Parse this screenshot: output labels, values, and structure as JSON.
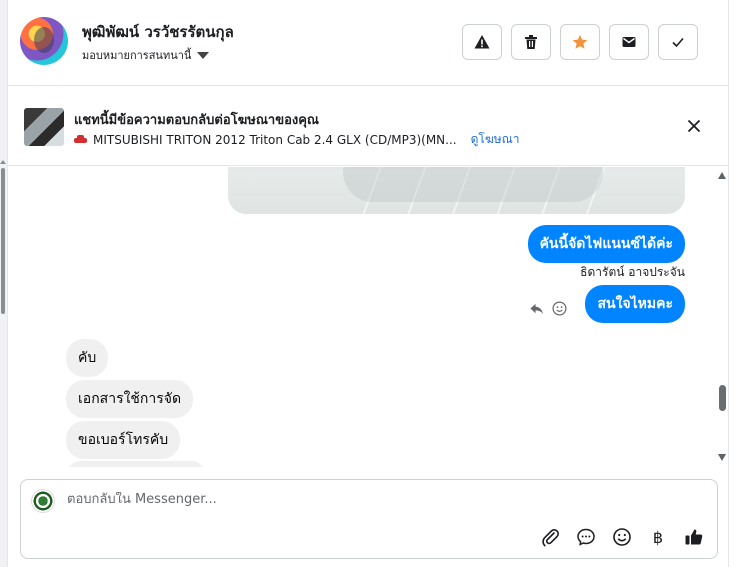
{
  "header": {
    "user_name": "พุฒิพัฒน์ วรวัชรรัตนกุล",
    "assign_label": "มอบหมายการสนทนานี้",
    "actions": [
      "warning-icon",
      "trash-icon",
      "star-icon",
      "mail-icon",
      "check-icon"
    ],
    "star_color": "#f5923e"
  },
  "ad": {
    "title": "แชทนี้มีข้อความตอบกลับต่อโฆษณาของคุณ",
    "car": "MITSUBISHI TRITON 2012 Triton Cab 2.4 GLX (CD/MP3)(MN...",
    "link": "ดูโฆษณา"
  },
  "messages": {
    "out_1": "คันนี้จัดไฟแนนซ์ได้ค่ะ",
    "sender": "ธิดารัตน์ อาจประจัน",
    "out_2": "สนใจไหมคะ",
    "in_1": "คับ",
    "in_2": "เอกสารใช้การจัด",
    "in_3": "ขอเบอร์โทรคับ"
  },
  "composer": {
    "placeholder": "ตอบกลับใน Messenger..."
  },
  "colors": {
    "accent": "#0084ff",
    "link": "#216fdb"
  }
}
